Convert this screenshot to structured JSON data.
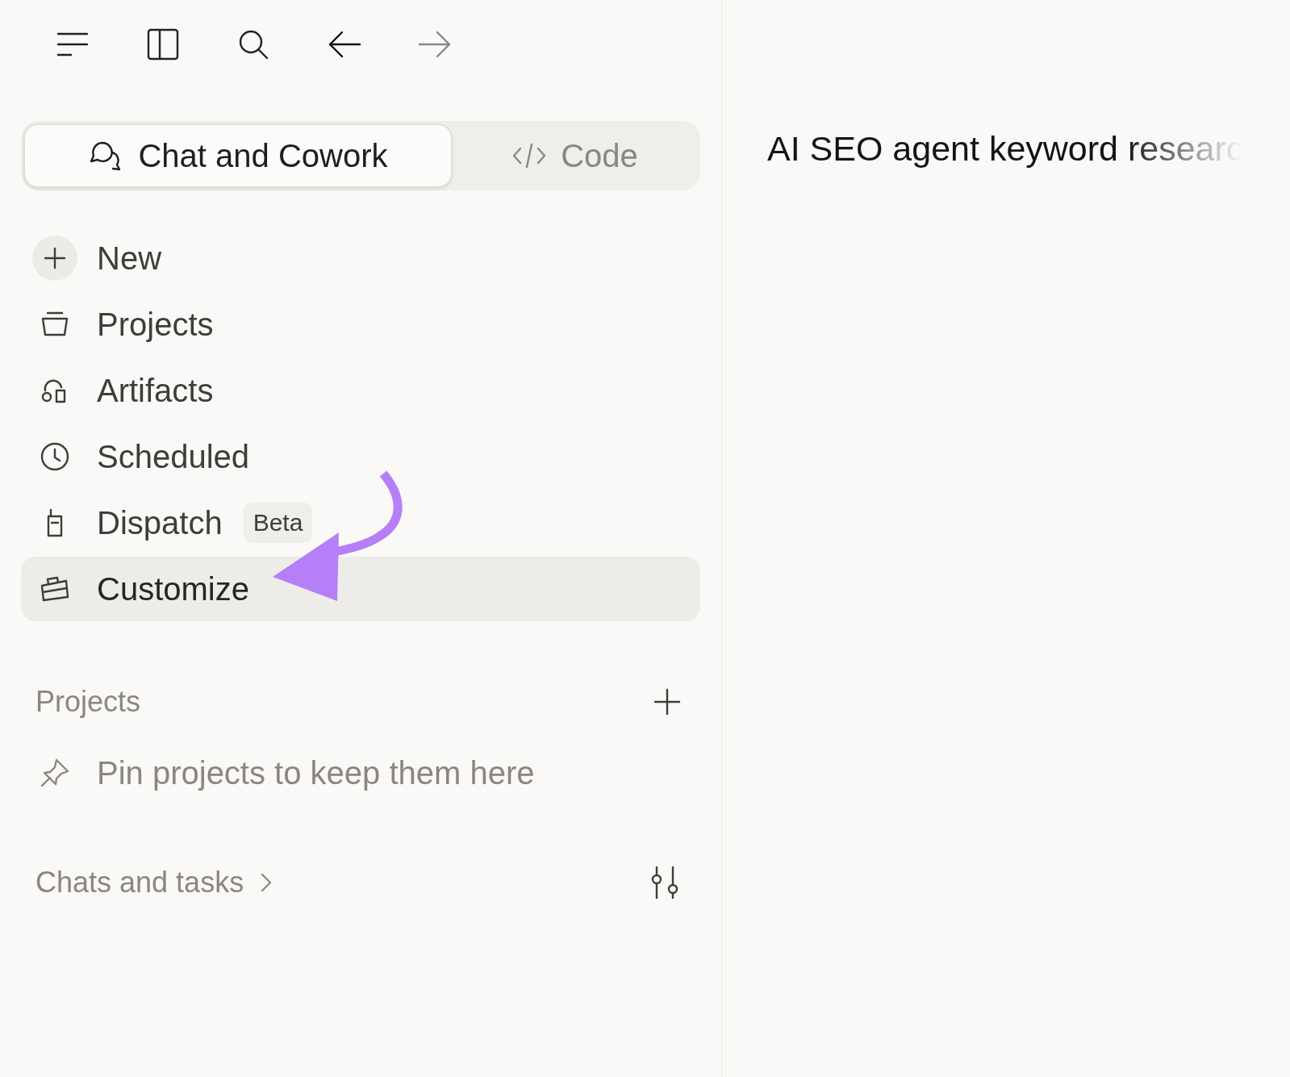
{
  "mode_tabs": [
    {
      "label": "Chat and Cowork",
      "kind": "chat",
      "selected": true
    },
    {
      "label": "Code",
      "kind": "code",
      "selected": false
    }
  ],
  "nav": [
    {
      "label": "New",
      "kind": "new",
      "selected": false
    },
    {
      "label": "Projects",
      "kind": "projects",
      "selected": false
    },
    {
      "label": "Artifacts",
      "kind": "artifacts",
      "selected": false
    },
    {
      "label": "Scheduled",
      "kind": "scheduled",
      "selected": false
    },
    {
      "label": "Dispatch",
      "kind": "dispatch",
      "badge": "Beta",
      "selected": false
    },
    {
      "label": "Customize",
      "kind": "customize",
      "selected": true
    }
  ],
  "projects_section": {
    "title": "Projects",
    "empty_hint": "Pin projects to keep them here"
  },
  "chats_section": {
    "title": "Chats and tasks"
  },
  "main": {
    "title": "AI SEO agent keyword researc"
  }
}
